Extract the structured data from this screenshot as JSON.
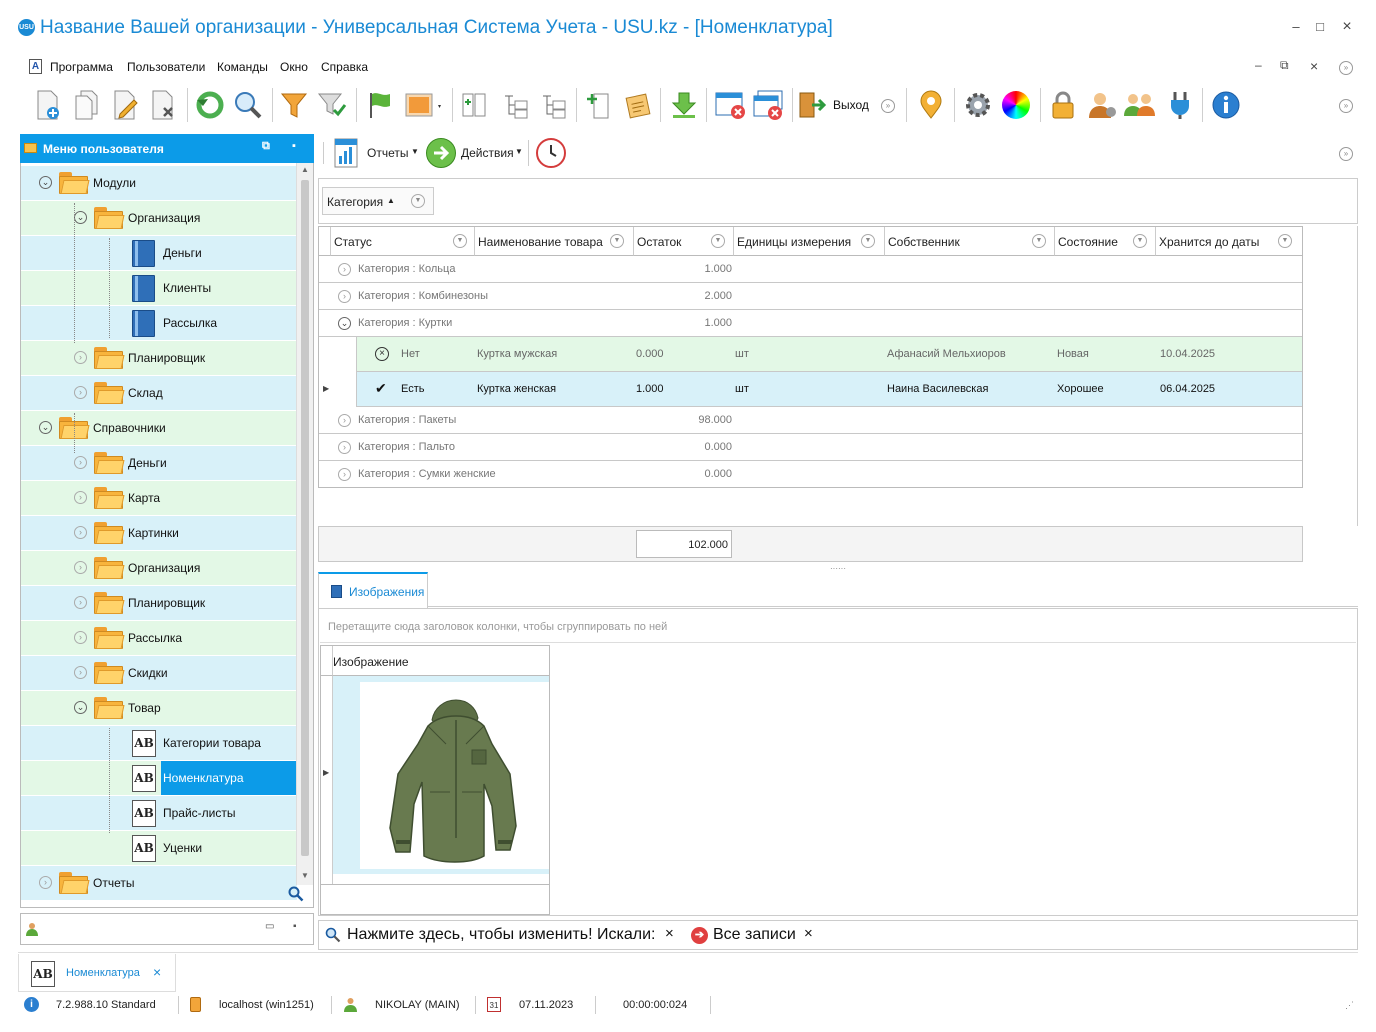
{
  "window": {
    "title": "Название Вашей организации - Универсальная Система Учета - USU.kz - [Номенклатура]",
    "logo_text": "USU",
    "controls": [
      "–",
      "□",
      "×"
    ]
  },
  "menubar": {
    "icon_text": "A",
    "items": [
      "Программа",
      "Пользователи",
      "Команды",
      "Окно",
      "Справка"
    ]
  },
  "toolbar": {
    "exit_label": "Выход"
  },
  "left_panel": {
    "title": "Меню пользователя",
    "tree": [
      {
        "label": "Модули",
        "level": 0,
        "kind": "folder",
        "expanded": true
      },
      {
        "label": "Организация",
        "level": 1,
        "kind": "folder",
        "expanded": true
      },
      {
        "label": "Деньги",
        "level": 2,
        "kind": "book"
      },
      {
        "label": "Клиенты",
        "level": 2,
        "kind": "book"
      },
      {
        "label": "Рассылка",
        "level": 2,
        "kind": "book"
      },
      {
        "label": "Планировщик",
        "level": 1,
        "kind": "folder",
        "expanded": false
      },
      {
        "label": "Склад",
        "level": 1,
        "kind": "folder",
        "expanded": false
      },
      {
        "label": "Справочники",
        "level": 0,
        "kind": "folder",
        "expanded": true
      },
      {
        "label": "Деньги",
        "level": 1,
        "kind": "folder",
        "expanded": false
      },
      {
        "label": "Карта",
        "level": 1,
        "kind": "folder",
        "expanded": false
      },
      {
        "label": "Картинки",
        "level": 1,
        "kind": "folder",
        "expanded": false
      },
      {
        "label": "Организация",
        "level": 1,
        "kind": "folder",
        "expanded": false
      },
      {
        "label": "Планировщик",
        "level": 1,
        "kind": "folder",
        "expanded": false
      },
      {
        "label": "Рассылка",
        "level": 1,
        "kind": "folder",
        "expanded": false
      },
      {
        "label": "Скидки",
        "level": 1,
        "kind": "folder",
        "expanded": false
      },
      {
        "label": "Товар",
        "level": 1,
        "kind": "folder",
        "expanded": true
      },
      {
        "label": "Категории товара",
        "level": 2,
        "kind": "ab"
      },
      {
        "label": "Номенклатура",
        "level": 2,
        "kind": "ab",
        "selected": true
      },
      {
        "label": "Прайс-листы",
        "level": 2,
        "kind": "ab"
      },
      {
        "label": "Уценки",
        "level": 2,
        "kind": "ab"
      },
      {
        "label": "Отчеты",
        "level": 0,
        "kind": "folder",
        "expanded": false
      }
    ]
  },
  "subtoolbar": {
    "reports_label": "Отчеты",
    "actions_label": "Действия"
  },
  "grid": {
    "group_chip": "Категория",
    "columns": [
      "Статус",
      "Наименование товара",
      "Остаток",
      "Единицы измерения",
      "Собственник",
      "Состояние",
      "Хранится до даты"
    ],
    "groups": [
      {
        "label": "Категория : Кольца",
        "total": "1.000"
      },
      {
        "label": "Категория : Комбинезоны",
        "total": "2.000"
      },
      {
        "label": "Категория : Куртки",
        "total": "1.000"
      },
      {
        "label": "Категория : Пакеты",
        "total": "98.000"
      },
      {
        "label": "Категория : Пальто",
        "total": "0.000"
      },
      {
        "label": "Категория : Сумки женские",
        "total": "0.000"
      }
    ],
    "rows": [
      {
        "status": "Нет",
        "name": "Куртка мужская",
        "rest": "0.000",
        "unit": "шт",
        "owner": "Афанасий Мельхиоров",
        "state": "Новая",
        "date": "10.04.2025"
      },
      {
        "status": "Есть",
        "name": "Куртка женская",
        "rest": "1.000",
        "unit": "шт",
        "owner": "Наина Василевская",
        "state": "Хорошее",
        "date": "06.04.2025"
      }
    ],
    "summary": "102.000"
  },
  "images": {
    "tab_label": "Изображения",
    "drag_hint": "Перетащите сюда заголовок колонки, чтобы сгруппировать по ней",
    "column": "Изображение"
  },
  "filterbar": {
    "text": "Нажмите здесь, чтобы изменить! Искали:",
    "all_records": "Все записи"
  },
  "taskbar": {
    "tab_label": "Номенклатура",
    "icon_text": "AB"
  },
  "statusbar": {
    "version": "7.2.988.10 Standard",
    "db": "localhost (win1251)",
    "user": "NIKOLAY (MAIN)",
    "calendar_day": "31",
    "date": "07.11.2023",
    "timer": "00:00:00:024"
  },
  "colors": {
    "accent": "#0c9be8",
    "row_blue": "#d8f1f9",
    "row_green": "#e3f8e6"
  }
}
